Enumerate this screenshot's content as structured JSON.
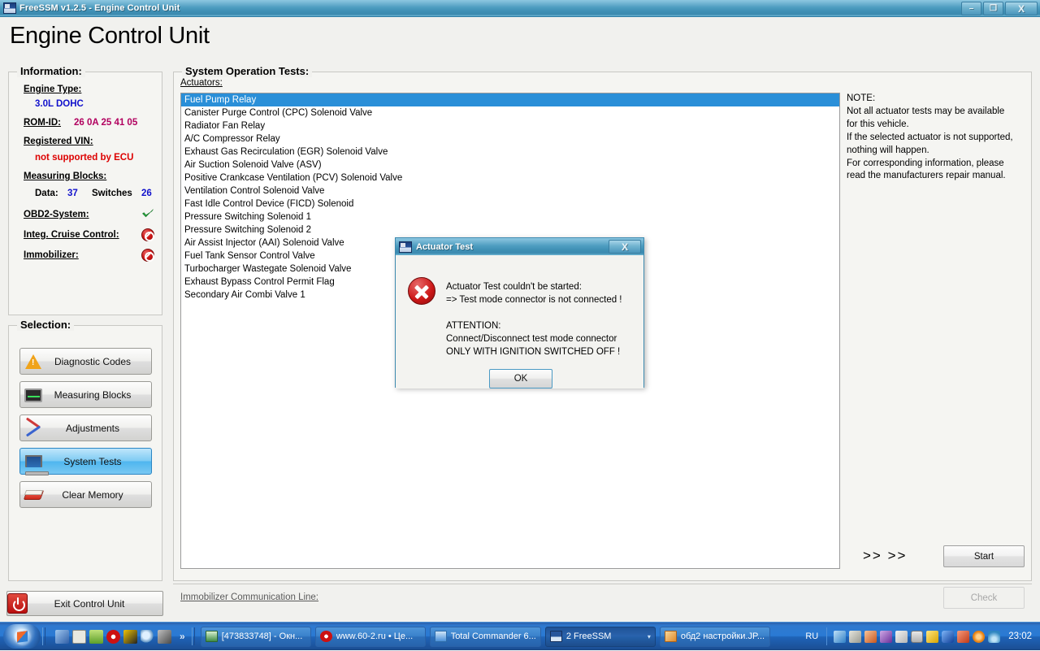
{
  "window": {
    "title": "FreeSSM v1.2.5 - Engine Control Unit",
    "minimize_label": "–",
    "maximize_label": "❐",
    "close_label": "X",
    "page_title": "Engine Control Unit"
  },
  "information": {
    "legend": "Information:",
    "engine_type_label": "Engine Type:",
    "engine_type_value": "3.0L DOHC",
    "rom_id_label": "ROM-ID:",
    "rom_id_value": "26 0A 25 41 05",
    "vin_label": "Registered VIN:",
    "vin_value": "not supported by ECU",
    "measuring_blocks_label": "Measuring Blocks:",
    "data_label": "Data:",
    "data_value": "37",
    "switches_label": "Switches",
    "switches_value": "26",
    "obd2_label": "OBD2-System:",
    "obd2_status": "supported",
    "cruise_label": "Integ. Cruise Control:",
    "cruise_status": "not supported",
    "immobilizer_label": "Immobilizer:",
    "immobilizer_status": "not supported"
  },
  "selection": {
    "legend": "Selection:",
    "items": [
      {
        "label": "Diagnostic Codes",
        "icon": "warning-triangle-icon",
        "active": false
      },
      {
        "label": "Measuring Blocks",
        "icon": "monitor-icon",
        "active": false
      },
      {
        "label": "Adjustments",
        "icon": "tools-icon",
        "active": false
      },
      {
        "label": "System Tests",
        "icon": "laptop-icon",
        "active": true
      },
      {
        "label": "Clear Memory",
        "icon": "eraser-icon",
        "active": false
      }
    ],
    "exit_label": "Exit Control Unit",
    "exit_icon": "power-icon"
  },
  "tests": {
    "legend": "System Operation Tests:",
    "actuators_label": "Actuators:",
    "actuators": [
      {
        "label": "Fuel Pump Relay",
        "selected": true
      },
      {
        "label": "Canister Purge Control (CPC) Solenoid Valve",
        "selected": false
      },
      {
        "label": "Radiator Fan Relay",
        "selected": false
      },
      {
        "label": "A/C Compressor Relay",
        "selected": false
      },
      {
        "label": "Exhaust Gas Recirculation (EGR) Solenoid Valve",
        "selected": false
      },
      {
        "label": "Air Suction Solenoid Valve (ASV)",
        "selected": false
      },
      {
        "label": "Positive Crankcase Ventilation (PCV) Solenoid Valve",
        "selected": false
      },
      {
        "label": "Ventilation Control Solenoid Valve",
        "selected": false
      },
      {
        "label": "Fast Idle Control Device (FICD) Solenoid",
        "selected": false
      },
      {
        "label": "Pressure Switching Solenoid 1",
        "selected": false
      },
      {
        "label": "Pressure Switching Solenoid 2",
        "selected": false
      },
      {
        "label": "Air Assist Injector (AAI) Solenoid Valve",
        "selected": false
      },
      {
        "label": "Fuel Tank Sensor Control Valve",
        "selected": false
      },
      {
        "label": "Turbocharger Wastegate Solenoid Valve",
        "selected": false
      },
      {
        "label": "Exhaust Bypass Control Permit Flag",
        "selected": false
      },
      {
        "label": "Secondary Air Combi Valve 1",
        "selected": false
      }
    ],
    "note": "NOTE:\nNot all actuator tests may be available\nfor this vehicle.\nIf the selected actuator is not supported,\nnothing will happen.\nFor corresponding information, please\nread the manufacturers repair manual.",
    "arrows": ">> >>",
    "start_label": "Start",
    "check_label": "Check",
    "immobilizer_line_label": "Immobilizer Communication Line:"
  },
  "dialog": {
    "title": "Actuator Test",
    "close_label": "X",
    "message": "Actuator Test couldn't be started:\n=> Test mode connector is not connected !\n\nATTENTION:\nConnect/Disconnect test mode connector\nONLY WITH IGNITION SWITCHED OFF !",
    "ok_label": "OK",
    "icon": "error-circle-icon"
  },
  "taskbar": {
    "start_label": "start",
    "quicklaunch": [
      {
        "name": "media-player-icon",
        "color": "#2f5fa8"
      },
      {
        "name": "floppy-save-icon",
        "color": "#e8e8e0"
      },
      {
        "name": "battery-icon",
        "color": "#7fc043"
      },
      {
        "name": "opera-icon",
        "color": "#cc1111"
      },
      {
        "name": "winamp-icon",
        "color": "#f2c300"
      },
      {
        "name": "search-icon",
        "color": "#8fb6d8"
      },
      {
        "name": "ghost-icon",
        "color": "#5a5a5a"
      }
    ],
    "overflow_label": "»",
    "tasks": [
      {
        "label": "[473833748] - Окн...",
        "icon_color": "#69b36b",
        "active": false,
        "caret": ""
      },
      {
        "label": "www.60-2.ru • Це...",
        "icon_color": "#cc1111",
        "active": false,
        "caret": ""
      },
      {
        "label": "Total Commander 6...",
        "icon_color": "#4a90d9",
        "active": false,
        "caret": ""
      },
      {
        "label": "2 FreeSSM",
        "icon_color": "#27559b",
        "active": true,
        "caret": "▾"
      },
      {
        "label": "обд2 настройки.JP...",
        "icon_color": "#e08a2a",
        "active": false,
        "caret": ""
      }
    ],
    "language": "RU",
    "tray_icons": [
      {
        "name": "network-icon",
        "color": "#2f7fc6"
      },
      {
        "name": "usb-icon",
        "color": "#b9b9b0"
      },
      {
        "name": "firewall-icon",
        "color": "#d96a2a"
      },
      {
        "name": "antivirus-icon",
        "color": "#8a4fb0"
      },
      {
        "name": "volume-icon",
        "color": "#e8e8e8"
      },
      {
        "name": "device-icon",
        "color": "#cfcfcf"
      },
      {
        "name": "warning-icon",
        "color": "#f0c000"
      },
      {
        "name": "bluetooth-icon",
        "color": "#1b5fc8"
      },
      {
        "name": "speaker-icon",
        "color": "#d94a2a"
      },
      {
        "name": "update-icon",
        "color": "#e8800f"
      },
      {
        "name": "wireless-icon",
        "color": "#3a9ad0"
      }
    ],
    "clock": "23:02"
  },
  "colors": {
    "accent_blue": "#2a8fd8",
    "title_blue": "#3e8fb4",
    "value_blue": "#1111cc",
    "value_magenta": "#b1005f",
    "value_red": "#dd0000",
    "taskbar_blue": "#2a7ad4"
  }
}
